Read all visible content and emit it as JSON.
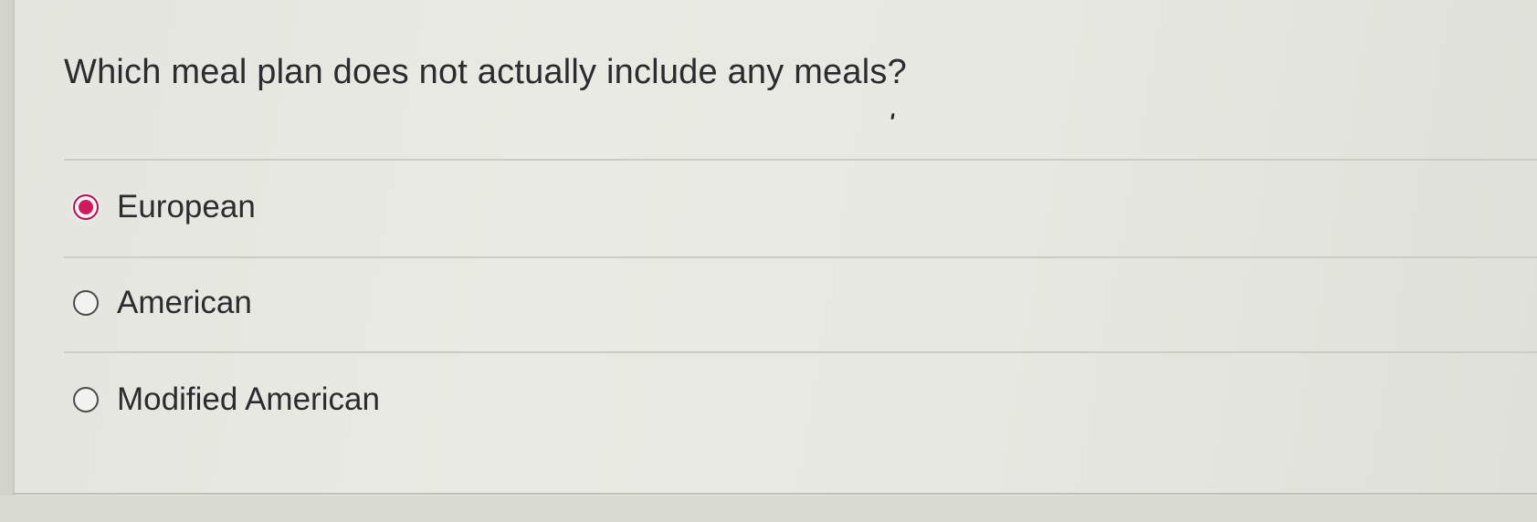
{
  "question": {
    "prompt": "Which meal plan does not actually  include any meals?"
  },
  "options": [
    {
      "label": "European",
      "selected": true
    },
    {
      "label": "American",
      "selected": false
    },
    {
      "label": "Modified American",
      "selected": false
    }
  ],
  "colors": {
    "selected_radio": "#cf1b5e",
    "text": "#2b2c2e",
    "background": "#e8e9e2"
  }
}
